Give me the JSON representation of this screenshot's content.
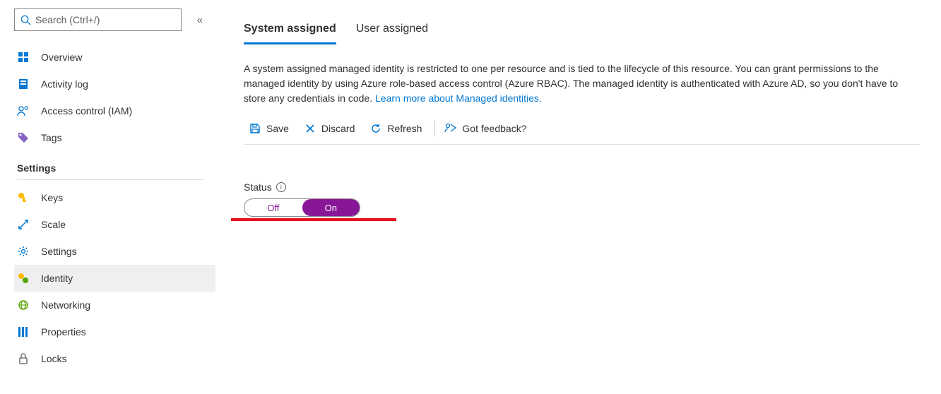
{
  "search": {
    "placeholder": "Search (Ctrl+/)"
  },
  "nav": {
    "items": [
      {
        "label": "Overview"
      },
      {
        "label": "Activity log"
      },
      {
        "label": "Access control (IAM)"
      },
      {
        "label": "Tags"
      }
    ],
    "sectionTitle": "Settings",
    "settingsItems": [
      {
        "label": "Keys"
      },
      {
        "label": "Scale"
      },
      {
        "label": "Settings"
      },
      {
        "label": "Identity"
      },
      {
        "label": "Networking"
      },
      {
        "label": "Properties"
      },
      {
        "label": "Locks"
      }
    ]
  },
  "tabs": {
    "systemAssigned": "System assigned",
    "userAssigned": "User assigned"
  },
  "description": "A system assigned managed identity is restricted to one per resource and is tied to the lifecycle of this resource. You can grant permissions to the managed identity by using Azure role-based access control (Azure RBAC). The managed identity is authenticated with Azure AD, so you don't have to store any credentials in code. ",
  "learnMore": "Learn more about Managed identities.",
  "cmdbar": {
    "save": "Save",
    "discard": "Discard",
    "refresh": "Refresh",
    "feedback": "Got feedback?"
  },
  "status": {
    "label": "Status",
    "off": "Off",
    "on": "On"
  }
}
